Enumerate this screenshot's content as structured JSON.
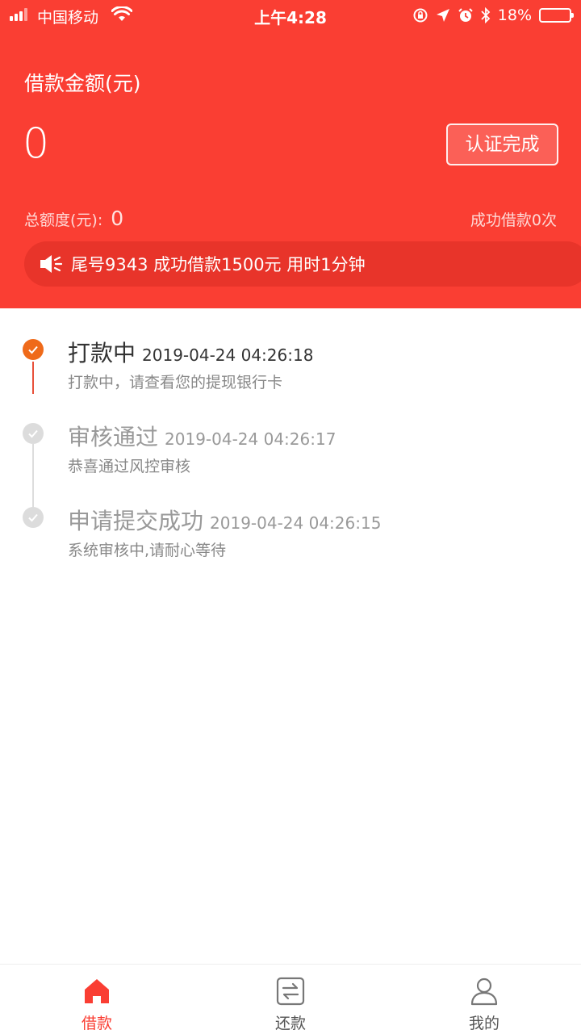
{
  "status_bar": {
    "carrier": "中国移动",
    "time": "上午4:28",
    "battery": "18%"
  },
  "header": {
    "loan_label": "借款金额(元)",
    "loan_amount": "0",
    "auth_button": "认证完成",
    "total_label": "总额度(元):",
    "total_value": "0",
    "success_count": "成功借款0次",
    "ticker": "尾号9343 成功借款1500元 用时1分钟"
  },
  "timeline": [
    {
      "title": "打款中",
      "time": "2019-04-24 04:26:18",
      "desc": "打款中，请查看您的提现银行卡",
      "active": true
    },
    {
      "title": "审核通过",
      "time": "2019-04-24 04:26:17",
      "desc": "恭喜通过风控审核",
      "active": false
    },
    {
      "title": "申请提交成功",
      "time": "2019-04-24 04:26:15",
      "desc": "系统审核中,请耐心等待",
      "active": false
    }
  ],
  "nav": {
    "items": [
      {
        "label": "借款",
        "icon": "home-icon",
        "active": true
      },
      {
        "label": "还款",
        "icon": "exchange-icon",
        "active": false
      },
      {
        "label": "我的",
        "icon": "user-icon",
        "active": false
      }
    ]
  },
  "colors": {
    "brand_red": "#fa3e33",
    "active_orange": "#ef6a1a",
    "inactive_gray": "#cccccc"
  }
}
